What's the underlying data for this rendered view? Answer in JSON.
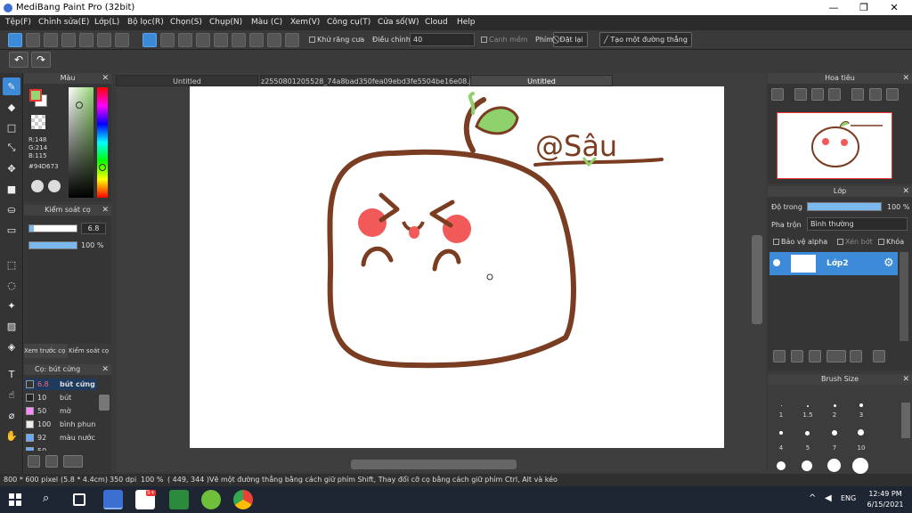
{
  "app": {
    "title": "MediBang Paint Pro (32bit)"
  },
  "window_controls": {
    "minimize": "—",
    "maximize": "❐",
    "close": "✕"
  },
  "menu": [
    "Tệp(F)",
    "Chỉnh sửa(E)",
    "Lớp(L)",
    "Bộ lọc(R)",
    "Chọn(S)",
    "Chụp(N)",
    "Màu (C)",
    "Xem(V)",
    "Công cụ(T)",
    "Cửa số(W)",
    "Cloud",
    "Help"
  ],
  "toolbar": {
    "antialias_label": "Khử răng cưa",
    "adjust_label": "Điều chỉnh",
    "adjust_value": "40",
    "soft_edge_label": "Canh mềm",
    "key_label": "Phím",
    "reset_label": "Đặt lại",
    "line_label": "Tạo một đường thẳng"
  },
  "color_panel": {
    "title": "Màu",
    "r": "R:148",
    "g": "G:214",
    "b": "B:115",
    "hex": "#94D673",
    "fg_color": "#94D673",
    "bg_color": "#ffffff"
  },
  "brush_control": {
    "title": "Kiểm soát cọ",
    "size": "6.8",
    "opacity": "100 %",
    "tab1": "Xem trước cọ",
    "tab2": "Kiểm soát cọ"
  },
  "brush_list": {
    "title": "Cọ: bút cứng",
    "items": [
      {
        "size": "6.8",
        "name": "bút cứng",
        "color": "#333333",
        "selected": true
      },
      {
        "size": "10",
        "name": "bút",
        "color": "#222222",
        "selected": false
      },
      {
        "size": "50",
        "name": "mờ",
        "color": "#ff88ff",
        "selected": false
      },
      {
        "size": "100",
        "name": "bình phun",
        "color": "#eeeeee",
        "selected": false
      },
      {
        "size": "92",
        "name": "màu nước",
        "color": "#66aaff",
        "selected": false
      },
      {
        "size": "50",
        "name": "",
        "color": "#66aaff",
        "selected": false
      }
    ]
  },
  "documents": {
    "tabs": [
      "Untitled",
      "z2550801205528_74a8bad350fea09ebd3fe5504be16e08.jpg",
      "Untitled"
    ],
    "active": 2
  },
  "drawing": {
    "watermark": "@Sâu"
  },
  "navigator": {
    "title": "Hoa tiêu"
  },
  "layer_panel": {
    "title": "Lớp",
    "opacity_label": "Độ trong",
    "opacity_value": "100 %",
    "blend_label": "Pha trộn",
    "blend_value": "Bình thường",
    "protect_alpha": "Bảo vệ alpha",
    "clip": "Xén bớt",
    "lock": "Khóa",
    "layer_name": "Lớp2"
  },
  "brush_size_panel": {
    "title": "Brush Size",
    "sizes": [
      "1",
      "1.5",
      "2",
      "3",
      "4",
      "5",
      "7",
      "10"
    ]
  },
  "status": {
    "size": "800 * 600 pixel",
    "cm": "(5.8 * 4.4cm)",
    "dpi": "350 dpi",
    "zoom": "100 %",
    "coords": "( 449, 344 )",
    "hint": "Vẽ một đường thẳng bằng cách giữ phím Shift, Thay đổi cỡ cọ bằng cách giữ phím Ctrl, Alt và kéo"
  },
  "taskbar": {
    "lang": "ENG",
    "time": "12:49 PM",
    "date": "6/15/2021",
    "badge": "5+"
  },
  "colors": {
    "accent": "#3d8ad9",
    "stroke": "#7a3d22",
    "cheek": "#f25a5a",
    "leaf": "#8fd16c"
  }
}
